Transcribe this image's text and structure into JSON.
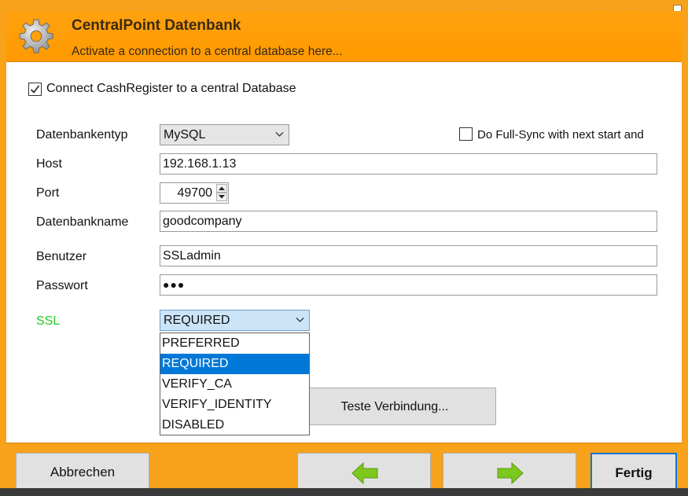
{
  "header": {
    "title": "CentralPoint Datenbank",
    "subtitle": "Activate a connection to a central database here...",
    "icon": "gear-icon"
  },
  "connect": {
    "label": "Connect CashRegister to a central Database",
    "checked": true
  },
  "fullsync": {
    "label": "Do Full-Sync with next start and",
    "checked": false
  },
  "form": {
    "db_type_label": "Datenbankentyp",
    "db_type_value": "MySQL",
    "host_label": "Host",
    "host_value": "192.168.1.13",
    "port_label": "Port",
    "port_value": "49700",
    "dbname_label": "Datenbankname",
    "dbname_value": "goodcompany",
    "user_label": "Benutzer",
    "user_value": "SSLadmin",
    "password_label": "Passwort",
    "password_value": "●●●",
    "ssl_label": "SSL",
    "ssl_value": "REQUIRED"
  },
  "ssl_options": [
    "PREFERRED",
    "REQUIRED",
    "VERIFY_CA",
    "VERIFY_IDENTITY",
    "DISABLED"
  ],
  "ssl_selected_index": 1,
  "test_button": "Teste Verbindung...",
  "footer": {
    "cancel": "Abbrechen",
    "back_icon": "arrow-left-icon",
    "next_icon": "arrow-right-icon",
    "finish": "Fertig"
  },
  "colors": {
    "accent": "#f7a21a",
    "ssl_label": "#22cc22",
    "selection": "#0078d7",
    "arrow_green": "#7cc81e"
  }
}
